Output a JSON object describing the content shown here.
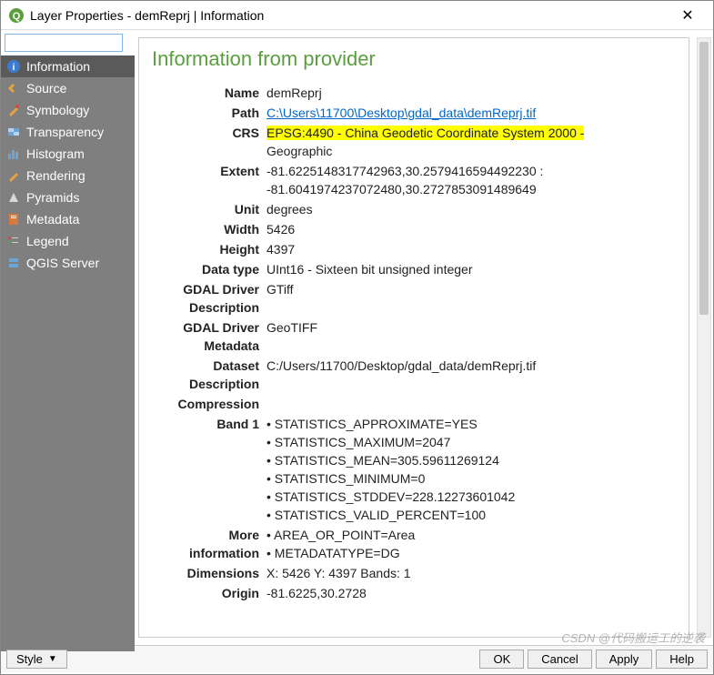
{
  "window": {
    "title": "Layer Properties - demReprj | Information",
    "close": "✕"
  },
  "search": {
    "placeholder": ""
  },
  "sidebar": {
    "items": [
      {
        "label": "Information",
        "icon": "info-icon",
        "active": true
      },
      {
        "label": "Source",
        "icon": "source-icon"
      },
      {
        "label": "Symbology",
        "icon": "symbology-icon"
      },
      {
        "label": "Transparency",
        "icon": "transparency-icon"
      },
      {
        "label": "Histogram",
        "icon": "histogram-icon"
      },
      {
        "label": "Rendering",
        "icon": "rendering-icon"
      },
      {
        "label": "Pyramids",
        "icon": "pyramids-icon"
      },
      {
        "label": "Metadata",
        "icon": "metadata-icon"
      },
      {
        "label": "Legend",
        "icon": "legend-icon"
      },
      {
        "label": "QGIS Server",
        "icon": "server-icon"
      }
    ]
  },
  "content": {
    "heading": "Information from provider",
    "name_label": "Name",
    "name_val": "demReprj",
    "path_label": "Path",
    "path_val": "C:\\Users\\11700\\Desktop\\gdal_data\\demReprj.tif",
    "crs_label": "CRS",
    "crs_hl": "EPSG:4490 - China Geodetic Coordinate System 2000 -",
    "crs_rest": "Geographic",
    "extent_label": "Extent",
    "extent_l1": "-81.6225148317742963,30.2579416594492230 :",
    "extent_l2": "-81.6041974237072480,30.2727853091489649",
    "unit_label": "Unit",
    "unit_val": "degrees",
    "width_label": "Width",
    "width_val": "5426",
    "height_label": "Height",
    "height_val": "4397",
    "dtype_label": "Data type",
    "dtype_val": "UInt16 - Sixteen bit unsigned integer",
    "gdaldesc_label1": "GDAL Driver",
    "gdaldesc_label2": "Description",
    "gdaldesc_val": "GTiff",
    "gdalmeta_label1": "GDAL Driver",
    "gdalmeta_label2": "Metadata",
    "gdalmeta_val": "GeoTIFF",
    "datasetdesc_label1": "Dataset",
    "datasetdesc_label2": "Description",
    "datasetdesc_val": "C:/Users/11700/Desktop/gdal_data/demReprj.tif",
    "compression_label": "Compression",
    "compression_val": "",
    "band1_label": "Band 1",
    "band1": [
      "STATISTICS_APPROXIMATE=YES",
      "STATISTICS_MAXIMUM=2047",
      "STATISTICS_MEAN=305.59611269124",
      "STATISTICS_MINIMUM=0",
      "STATISTICS_STDDEV=228.12273601042",
      "STATISTICS_VALID_PERCENT=100"
    ],
    "moreinfo_label1": "More",
    "moreinfo_label2": "information",
    "moreinfo": [
      "AREA_OR_POINT=Area",
      "METADATATYPE=DG"
    ],
    "dim_label": "Dimensions",
    "dim_val": "X: 5426 Y: 4397 Bands: 1",
    "origin_label": "Origin",
    "origin_val": "-81.6225,30.2728"
  },
  "footer": {
    "style": "Style",
    "ok": "OK",
    "cancel": "Cancel",
    "apply": "Apply",
    "help": "Help"
  },
  "watermark": "CSDN @代码搬运工的逆袭"
}
